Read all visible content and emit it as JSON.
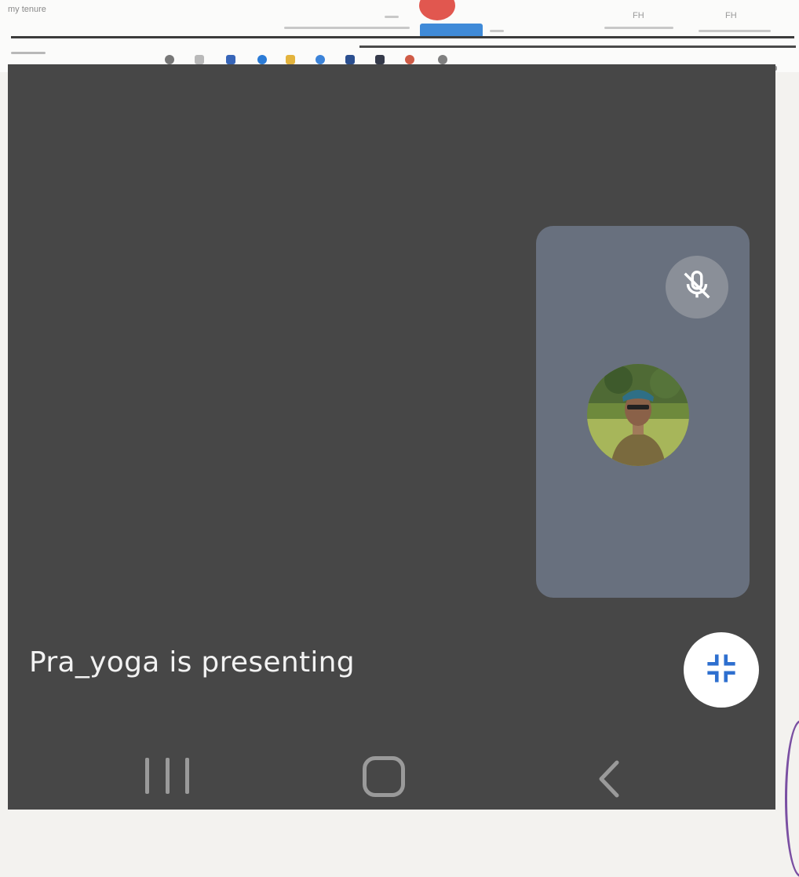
{
  "shared_screen": {
    "top_left_label": "my tenure",
    "top_right_labels": [
      "FH",
      "FH"
    ]
  },
  "call": {
    "presenting_text": "Pra_yoga is presenting",
    "participant_muted": true
  },
  "icons": {
    "mic_off": "mic-off-icon",
    "exit_fullscreen": "exit-fullscreen-icon",
    "recent_apps": "recent-apps-icon",
    "home": "home-icon",
    "back": "back-icon"
  },
  "colors": {
    "stage": "#474747",
    "pip_tile": "#68707e",
    "presenting_text": "#f2f2f2",
    "shrink_icon": "#2e6fcf"
  }
}
